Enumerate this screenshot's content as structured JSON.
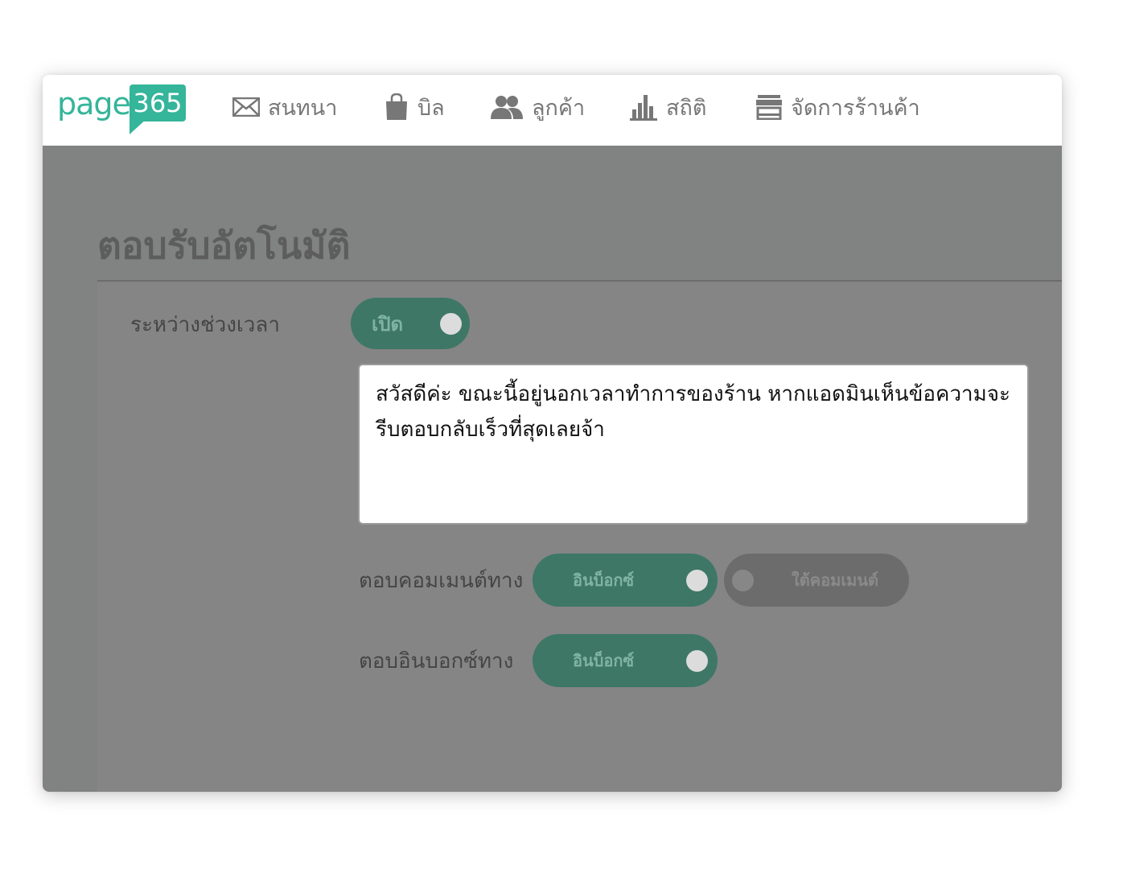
{
  "logo": {
    "page_text": "page",
    "number_text": "365",
    "brand_color": "#35b59a"
  },
  "nav": {
    "items": [
      {
        "label": "สนทนา",
        "icon": "envelope-icon"
      },
      {
        "label": "บิล",
        "icon": "shopping-bag-icon"
      },
      {
        "label": "ลูกค้า",
        "icon": "users-icon"
      },
      {
        "label": "สถิติ",
        "icon": "bar-chart-icon"
      },
      {
        "label": "จัดการร้านค้า",
        "icon": "store-icon"
      }
    ]
  },
  "page": {
    "title": "ตอบรับอัตโนมัติ"
  },
  "schedule": {
    "label": "ระหว่างช่วงเวลา",
    "toggle_label": "เปิด",
    "toggle_on": true
  },
  "message": {
    "value": "สวัสดีค่ะ ขณะนี้อยู่นอกเวลาทำการของร้าน หากแอดมินเห็นข้อความจะรีบตอบกลับเร็วที่สุดเลยจ้า"
  },
  "comment_reply": {
    "label": "ตอบคอมเมนต์ทาง",
    "inbox_option": {
      "label": "อินบ็อกซ์",
      "on": true
    },
    "comment_option": {
      "label": "ใต้คอมเมนต์",
      "on": false
    }
  },
  "inbox_reply": {
    "label": "ตอบอินบอกซ์ทาง",
    "inbox_option": {
      "label": "อินบ็อกซ์",
      "on": true
    }
  },
  "colors": {
    "overlay": "#818282",
    "toggle_on": "#3e7766",
    "toggle_off": "#6c6c6c"
  }
}
